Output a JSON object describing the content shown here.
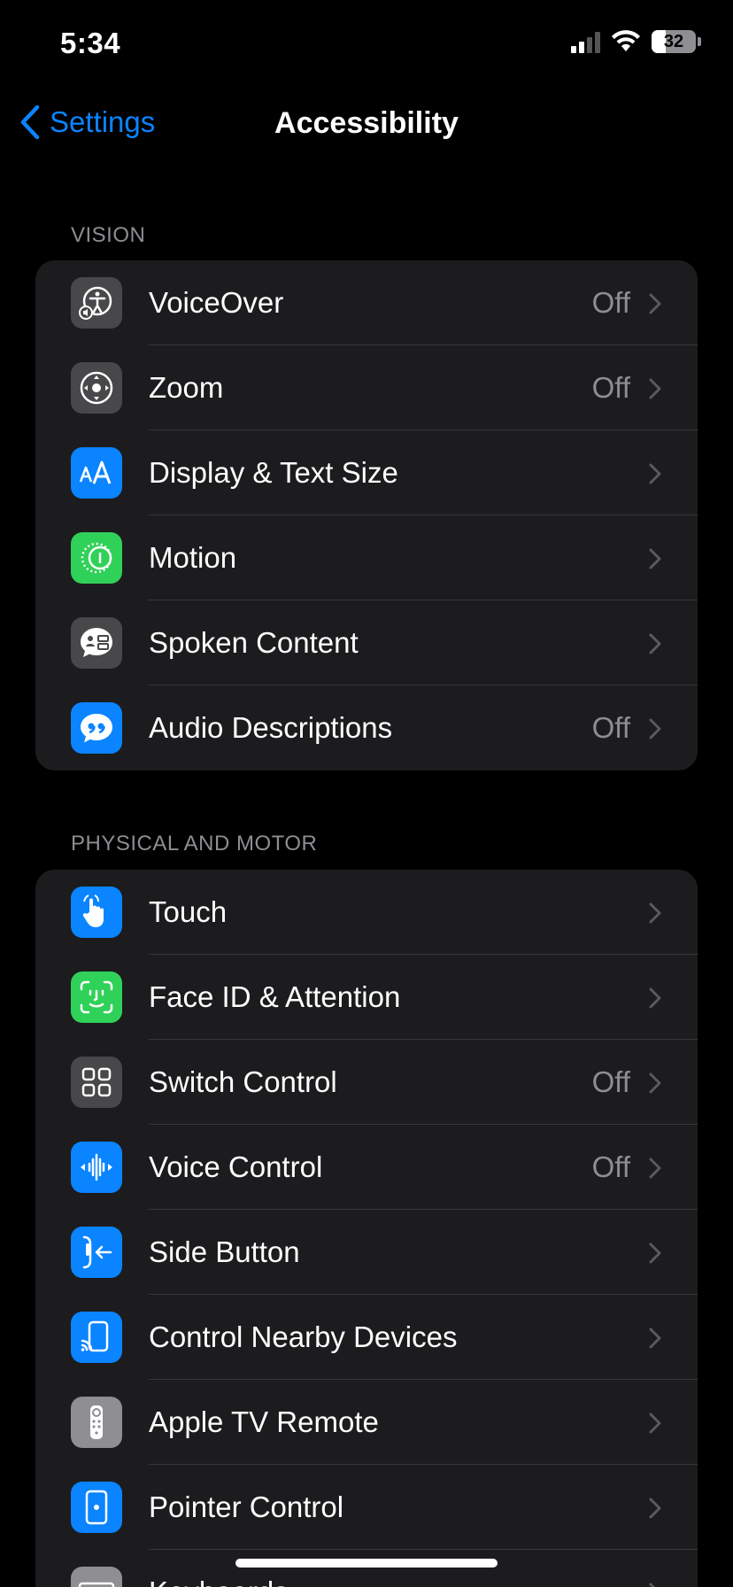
{
  "status": {
    "time": "5:34",
    "battery": "32"
  },
  "nav": {
    "back_label": "Settings",
    "title": "Accessibility"
  },
  "sections": [
    {
      "header": "VISION",
      "items": [
        {
          "label": "VoiceOver",
          "value": "Off",
          "icon": "voiceover-icon",
          "color": "#48484a"
        },
        {
          "label": "Zoom",
          "value": "Off",
          "icon": "zoom-icon",
          "color": "#48484a"
        },
        {
          "label": "Display & Text Size",
          "value": "",
          "icon": "text-size-icon",
          "color": "#0a84ff"
        },
        {
          "label": "Motion",
          "value": "",
          "icon": "motion-icon",
          "color": "#30d158"
        },
        {
          "label": "Spoken Content",
          "value": "",
          "icon": "spoken-content-icon",
          "color": "#48484a"
        },
        {
          "label": "Audio Descriptions",
          "value": "Off",
          "icon": "audio-descriptions-icon",
          "color": "#0a84ff"
        }
      ]
    },
    {
      "header": "PHYSICAL AND MOTOR",
      "items": [
        {
          "label": "Touch",
          "value": "",
          "icon": "touch-icon",
          "color": "#0a84ff"
        },
        {
          "label": "Face ID & Attention",
          "value": "",
          "icon": "face-id-icon",
          "color": "#30d158"
        },
        {
          "label": "Switch Control",
          "value": "Off",
          "icon": "switch-control-icon",
          "color": "#48484a"
        },
        {
          "label": "Voice Control",
          "value": "Off",
          "icon": "voice-control-icon",
          "color": "#0a84ff"
        },
        {
          "label": "Side Button",
          "value": "",
          "icon": "side-button-icon",
          "color": "#0a84ff"
        },
        {
          "label": "Control Nearby Devices",
          "value": "",
          "icon": "nearby-devices-icon",
          "color": "#0a84ff"
        },
        {
          "label": "Apple TV Remote",
          "value": "",
          "icon": "tv-remote-icon",
          "color": "#8e8e93"
        },
        {
          "label": "Pointer Control",
          "value": "",
          "icon": "pointer-control-icon",
          "color": "#0a84ff"
        },
        {
          "label": "Keyboards",
          "value": "",
          "icon": "keyboard-icon",
          "color": "#8e8e93"
        }
      ]
    }
  ]
}
